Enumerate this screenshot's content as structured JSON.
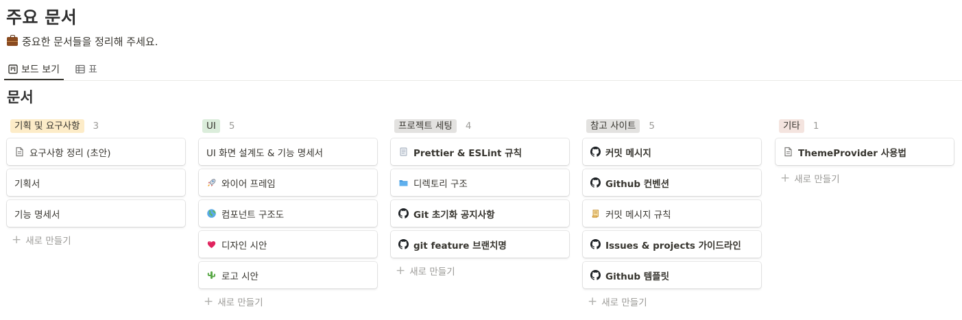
{
  "page": {
    "title": "주요 문서",
    "description": "중요한 문서들을 정리해 주세요."
  },
  "tabs": [
    {
      "label": "보드 보기",
      "icon": "board-icon",
      "active": true
    },
    {
      "label": "표",
      "icon": "table-icon",
      "active": false
    }
  ],
  "section": {
    "title": "문서"
  },
  "new_label": "새로 만들기",
  "columns": [
    {
      "tag": "기획 및 요구사항",
      "count": "3",
      "tag_color": "#fdecc8",
      "cards": [
        {
          "title": "요구사항 정리 (초안)",
          "icon": "document-icon"
        },
        {
          "title": "기획서",
          "icon": ""
        },
        {
          "title": "기능 명세서",
          "icon": ""
        }
      ]
    },
    {
      "tag": "UI",
      "count": "5",
      "tag_color": "#dbeddb",
      "cards": [
        {
          "title": "UI 화면 설계도 & 기능 명세서",
          "icon": ""
        },
        {
          "title": "와이어 프레임",
          "icon": "rocket-icon"
        },
        {
          "title": "컴포넌트 구조도",
          "icon": "globe-icon"
        },
        {
          "title": "디자인 시안",
          "icon": "heart-icon"
        },
        {
          "title": "로고 시안",
          "icon": "cactus-icon"
        }
      ]
    },
    {
      "tag": "프로젝트 세팅",
      "count": "4",
      "tag_color": "#e3e2e0",
      "cards": [
        {
          "title": "Prettier & ESLint 규칙",
          "icon": "memo-icon"
        },
        {
          "title": "디렉토리 구조",
          "icon": "folder-icon"
        },
        {
          "title": "Git 초기화 공지사항",
          "icon": "github-icon"
        },
        {
          "title": "git feature 브랜치명",
          "icon": "github-icon"
        }
      ]
    },
    {
      "tag": "참고 사이트",
      "count": "5",
      "tag_color": "#e3e2e0",
      "cards": [
        {
          "title": "커밋 메시지",
          "icon": "github-icon"
        },
        {
          "title": "Github 컨벤션",
          "icon": "github-icon"
        },
        {
          "title": "커밋 메시지 규칙",
          "icon": "scroll-icon"
        },
        {
          "title": "Issues & projects 가이드라인",
          "icon": "github-icon"
        },
        {
          "title": "Github 템플릿",
          "icon": "github-icon"
        }
      ]
    },
    {
      "tag": "기타",
      "count": "1",
      "tag_color": "#f4e4df",
      "cards": [
        {
          "title": "ThemeProvider 사용법",
          "icon": "document-icon"
        }
      ]
    }
  ]
}
